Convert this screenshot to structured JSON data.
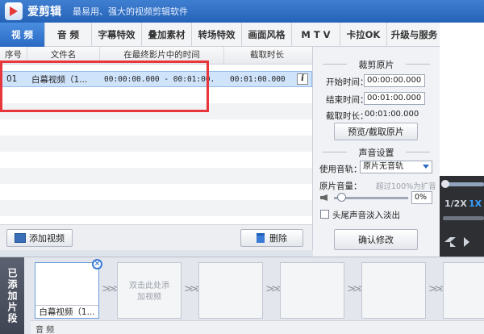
{
  "app": {
    "name": "爱剪辑",
    "slogan": "最易用、强大的视频剪辑软件"
  },
  "tabs": [
    {
      "label": "视 频",
      "active": true
    },
    {
      "label": "音 频"
    },
    {
      "label": "字幕特效"
    },
    {
      "label": "叠加素材"
    },
    {
      "label": "转场特效"
    },
    {
      "label": "画面风格"
    },
    {
      "label": "M T V"
    },
    {
      "label": "卡拉OK"
    },
    {
      "label": "升级与服务"
    }
  ],
  "clip_table": {
    "headers": [
      "序号",
      "文件名",
      "在最终影片中的时间",
      "截取时长"
    ],
    "rows": [
      {
        "index": "01",
        "filename": "白幕视频（1...",
        "timespan": "00:00:00.000 - 00:01:00.",
        "duration": "00:01:00.000"
      }
    ]
  },
  "buttons": {
    "add_video": "添加视频",
    "delete": "删除",
    "preview_cut": "预览/截取原片",
    "confirm": "确认修改"
  },
  "cut_panel": {
    "title": "裁剪原片",
    "start_label": "开始时间：",
    "start_value": "00:00:00.000",
    "end_label": "结束时间：",
    "end_value": "00:01:00.000",
    "duration_label": "截取时长：",
    "duration_value": "00:01:00.000"
  },
  "audio_panel": {
    "title": "声音设置",
    "track_label": "使用音轨：",
    "track_value": "原片无音轨",
    "volume_label": "原片音量：",
    "volume_hint": "超过100%为扩音",
    "volume_value": "0%",
    "fade_label": "头尾声音淡入淡出"
  },
  "player": {
    "speed_half": "1/2X",
    "speed_1x": "1X"
  },
  "bottom": {
    "tab": "已添加片段",
    "clip_label": "白幕视频（1...",
    "empty_hint": "双击此处添加视频",
    "audio_label": "音 频"
  },
  "colors": {
    "accent": "#2a6ac4",
    "highlight": "#e8373a"
  }
}
